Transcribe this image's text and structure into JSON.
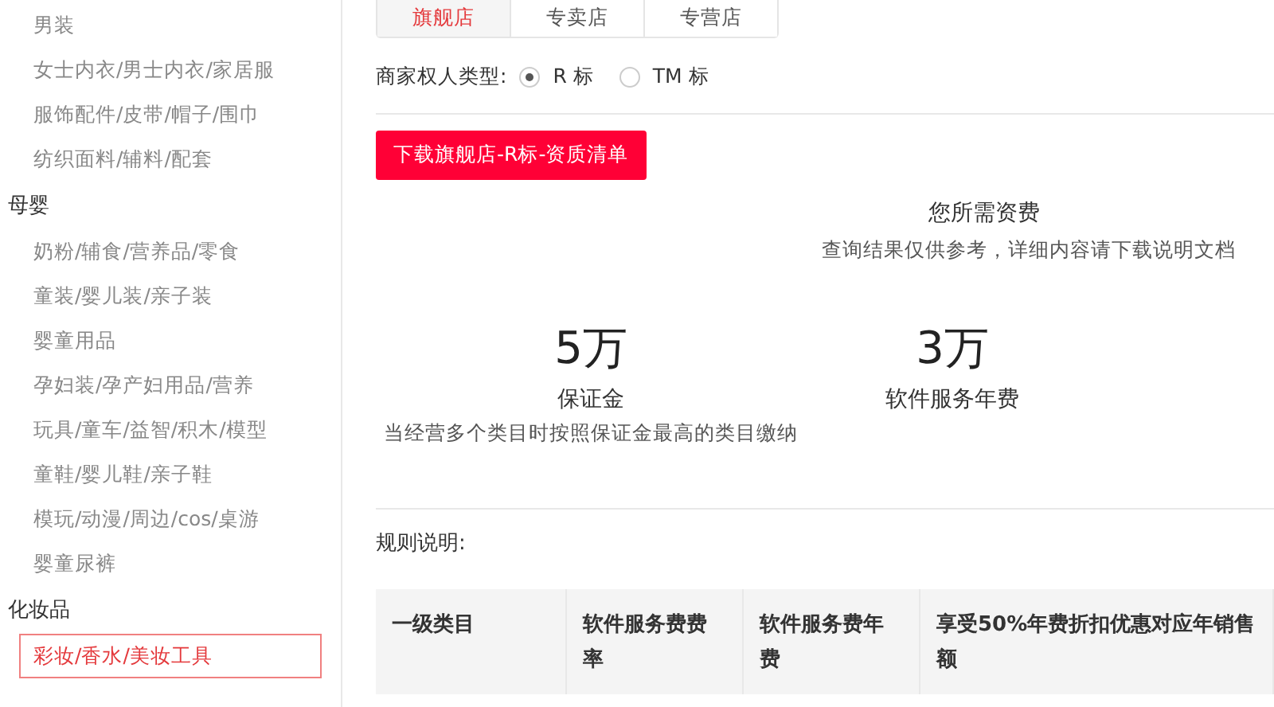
{
  "sidebar": {
    "groups": [
      {
        "items": [
          {
            "label": "男装",
            "selected": false
          },
          {
            "label": "女士内衣/男士内衣/家居服",
            "selected": false
          },
          {
            "label": "服饰配件/皮带/帽子/围巾",
            "selected": false
          },
          {
            "label": "纺织面料/辅料/配套",
            "selected": false
          }
        ]
      },
      {
        "title": "母婴",
        "items": [
          {
            "label": "奶粉/辅食/营养品/零食",
            "selected": false
          },
          {
            "label": "童装/婴儿装/亲子装",
            "selected": false
          },
          {
            "label": "婴童用品",
            "selected": false
          },
          {
            "label": "孕妇装/孕产妇用品/营养",
            "selected": false
          },
          {
            "label": "玩具/童车/益智/积木/模型",
            "selected": false
          },
          {
            "label": "童鞋/婴儿鞋/亲子鞋",
            "selected": false
          },
          {
            "label": "模玩/动漫/周边/cos/桌游",
            "selected": false
          },
          {
            "label": "婴童尿裤",
            "selected": false
          }
        ]
      },
      {
        "title": "化妆品",
        "items": [
          {
            "label": "彩妆/香水/美妆工具",
            "selected": true
          }
        ]
      }
    ]
  },
  "tabs": [
    {
      "label": "旗舰店",
      "selected": true
    },
    {
      "label": "专卖店",
      "selected": false
    },
    {
      "label": "专营店",
      "selected": false
    }
  ],
  "owner_type": {
    "label": "商家权人类型:",
    "options": [
      {
        "label": "R 标",
        "selected": true
      },
      {
        "label": "TM 标",
        "selected": false
      }
    ]
  },
  "download_button": "下载旗舰店-R标-资质清单",
  "fees": {
    "title": "您所需资费",
    "subtitle": "查询结果仅供参考，详细内容请下载说明文档",
    "items": [
      {
        "amount": "5万",
        "label": "保证金",
        "note": "当经营多个类目时按照保证金最高的类目缴纳"
      },
      {
        "amount": "3万",
        "label": "软件服务年费"
      }
    ]
  },
  "rules": {
    "title": "规则说明:",
    "columns": [
      "一级类目",
      "软件服务费费率",
      "软件服务费年费",
      "享受50%年费折扣优惠对应年销售额"
    ]
  }
}
